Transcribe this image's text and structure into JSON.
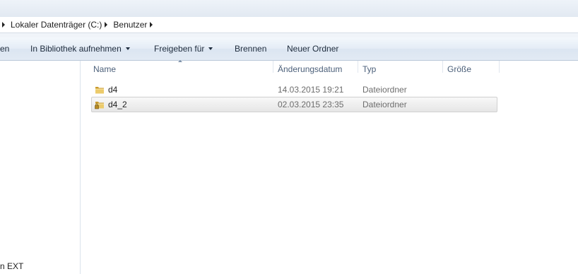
{
  "address": {
    "crumbs": [
      "Lokaler Datenträger (C:)",
      "Benutzer"
    ]
  },
  "commands": {
    "partial": "en",
    "library": "In Bibliothek aufnehmen",
    "share": "Freigeben für",
    "burn": "Brennen",
    "new_folder": "Neuer Ordner"
  },
  "nav": {
    "partial_item": "n EXT"
  },
  "columns": {
    "name": "Name",
    "modified": "Änderungsdatum",
    "type": "Typ",
    "size": "Größe"
  },
  "files": [
    {
      "name": "d4",
      "modified": "14.03.2015 19:21",
      "type": "Dateiordner",
      "size": "",
      "selected": false,
      "locked": false
    },
    {
      "name": "d4_2",
      "modified": "02.03.2015 23:35",
      "type": "Dateiordner",
      "size": "",
      "selected": true,
      "locked": true
    }
  ],
  "colors": {
    "folder": "#e8c25a",
    "folder_dark": "#c99a2e",
    "lock": "#c8a23a"
  }
}
